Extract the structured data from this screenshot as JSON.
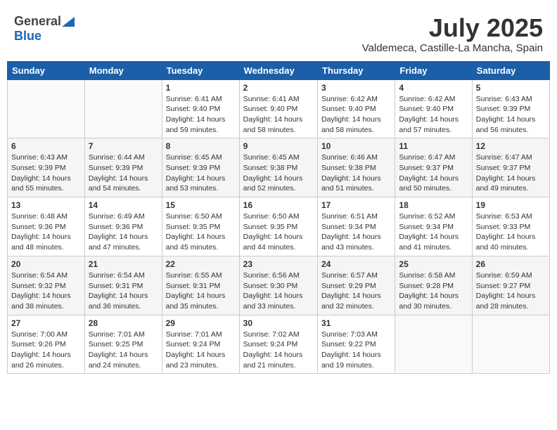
{
  "header": {
    "logo_general": "General",
    "logo_blue": "Blue",
    "month_year": "July 2025",
    "location": "Valdemeca, Castille-La Mancha, Spain"
  },
  "weekdays": [
    "Sunday",
    "Monday",
    "Tuesday",
    "Wednesday",
    "Thursday",
    "Friday",
    "Saturday"
  ],
  "weeks": [
    [
      {
        "day": "",
        "info": ""
      },
      {
        "day": "",
        "info": ""
      },
      {
        "day": "1",
        "info": "Sunrise: 6:41 AM\nSunset: 9:40 PM\nDaylight: 14 hours and 59 minutes."
      },
      {
        "day": "2",
        "info": "Sunrise: 6:41 AM\nSunset: 9:40 PM\nDaylight: 14 hours and 58 minutes."
      },
      {
        "day": "3",
        "info": "Sunrise: 6:42 AM\nSunset: 9:40 PM\nDaylight: 14 hours and 58 minutes."
      },
      {
        "day": "4",
        "info": "Sunrise: 6:42 AM\nSunset: 9:40 PM\nDaylight: 14 hours and 57 minutes."
      },
      {
        "day": "5",
        "info": "Sunrise: 6:43 AM\nSunset: 9:39 PM\nDaylight: 14 hours and 56 minutes."
      }
    ],
    [
      {
        "day": "6",
        "info": "Sunrise: 6:43 AM\nSunset: 9:39 PM\nDaylight: 14 hours and 55 minutes."
      },
      {
        "day": "7",
        "info": "Sunrise: 6:44 AM\nSunset: 9:39 PM\nDaylight: 14 hours and 54 minutes."
      },
      {
        "day": "8",
        "info": "Sunrise: 6:45 AM\nSunset: 9:39 PM\nDaylight: 14 hours and 53 minutes."
      },
      {
        "day": "9",
        "info": "Sunrise: 6:45 AM\nSunset: 9:38 PM\nDaylight: 14 hours and 52 minutes."
      },
      {
        "day": "10",
        "info": "Sunrise: 6:46 AM\nSunset: 9:38 PM\nDaylight: 14 hours and 51 minutes."
      },
      {
        "day": "11",
        "info": "Sunrise: 6:47 AM\nSunset: 9:37 PM\nDaylight: 14 hours and 50 minutes."
      },
      {
        "day": "12",
        "info": "Sunrise: 6:47 AM\nSunset: 9:37 PM\nDaylight: 14 hours and 49 minutes."
      }
    ],
    [
      {
        "day": "13",
        "info": "Sunrise: 6:48 AM\nSunset: 9:36 PM\nDaylight: 14 hours and 48 minutes."
      },
      {
        "day": "14",
        "info": "Sunrise: 6:49 AM\nSunset: 9:36 PM\nDaylight: 14 hours and 47 minutes."
      },
      {
        "day": "15",
        "info": "Sunrise: 6:50 AM\nSunset: 9:35 PM\nDaylight: 14 hours and 45 minutes."
      },
      {
        "day": "16",
        "info": "Sunrise: 6:50 AM\nSunset: 9:35 PM\nDaylight: 14 hours and 44 minutes."
      },
      {
        "day": "17",
        "info": "Sunrise: 6:51 AM\nSunset: 9:34 PM\nDaylight: 14 hours and 43 minutes."
      },
      {
        "day": "18",
        "info": "Sunrise: 6:52 AM\nSunset: 9:34 PM\nDaylight: 14 hours and 41 minutes."
      },
      {
        "day": "19",
        "info": "Sunrise: 6:53 AM\nSunset: 9:33 PM\nDaylight: 14 hours and 40 minutes."
      }
    ],
    [
      {
        "day": "20",
        "info": "Sunrise: 6:54 AM\nSunset: 9:32 PM\nDaylight: 14 hours and 38 minutes."
      },
      {
        "day": "21",
        "info": "Sunrise: 6:54 AM\nSunset: 9:31 PM\nDaylight: 14 hours and 36 minutes."
      },
      {
        "day": "22",
        "info": "Sunrise: 6:55 AM\nSunset: 9:31 PM\nDaylight: 14 hours and 35 minutes."
      },
      {
        "day": "23",
        "info": "Sunrise: 6:56 AM\nSunset: 9:30 PM\nDaylight: 14 hours and 33 minutes."
      },
      {
        "day": "24",
        "info": "Sunrise: 6:57 AM\nSunset: 9:29 PM\nDaylight: 14 hours and 32 minutes."
      },
      {
        "day": "25",
        "info": "Sunrise: 6:58 AM\nSunset: 9:28 PM\nDaylight: 14 hours and 30 minutes."
      },
      {
        "day": "26",
        "info": "Sunrise: 6:59 AM\nSunset: 9:27 PM\nDaylight: 14 hours and 28 minutes."
      }
    ],
    [
      {
        "day": "27",
        "info": "Sunrise: 7:00 AM\nSunset: 9:26 PM\nDaylight: 14 hours and 26 minutes."
      },
      {
        "day": "28",
        "info": "Sunrise: 7:01 AM\nSunset: 9:25 PM\nDaylight: 14 hours and 24 minutes."
      },
      {
        "day": "29",
        "info": "Sunrise: 7:01 AM\nSunset: 9:24 PM\nDaylight: 14 hours and 23 minutes."
      },
      {
        "day": "30",
        "info": "Sunrise: 7:02 AM\nSunset: 9:24 PM\nDaylight: 14 hours and 21 minutes."
      },
      {
        "day": "31",
        "info": "Sunrise: 7:03 AM\nSunset: 9:22 PM\nDaylight: 14 hours and 19 minutes."
      },
      {
        "day": "",
        "info": ""
      },
      {
        "day": "",
        "info": ""
      }
    ]
  ]
}
